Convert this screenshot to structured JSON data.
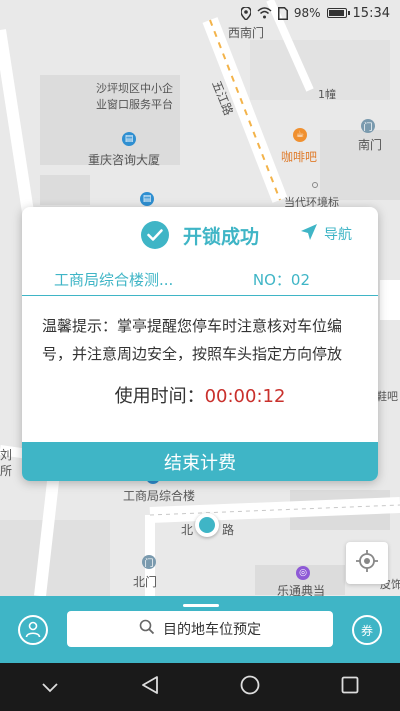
{
  "status_bar": {
    "battery": "98%",
    "time": "15:34",
    "battery_level": 0.98
  },
  "map": {
    "labels": {
      "ximen": "西南门",
      "shapingba": "沙坪坝区中小企",
      "shapingba2": "业窗口服务平台",
      "wujiang_road": "五江路",
      "building1": "1幢",
      "south_gate": "南门",
      "coffee": "咖啡吧",
      "chongqing_consult": "重庆咨询大厦",
      "huanjing": "当代环境标",
      "gongshang_building": "工商局综合楼",
      "north_road": "北",
      "north_road2": "路",
      "north_gate": "北门",
      "letong": "乐通典当",
      "left_label1": "刘",
      "left_label2": "所",
      "right_label1": "鞋吧",
      "right_label2": "皮饰"
    }
  },
  "card": {
    "title": "开锁成功",
    "nav_label": "导航",
    "location": "工商局综合楼测...",
    "number": "NO：02",
    "tip": "温馨提示：掌亭提醒您停车时注意核对车位编号，并注意周边安全，按照车头指定方向停放",
    "usage_label": "使用时间：",
    "usage_time": "00:00:12",
    "end_button": "结束计费"
  },
  "bottom": {
    "search_placeholder": "目的地车位预定",
    "coupon_label": "券"
  },
  "colors": {
    "accent": "#3fb5c6",
    "time_red": "#c9302c"
  }
}
